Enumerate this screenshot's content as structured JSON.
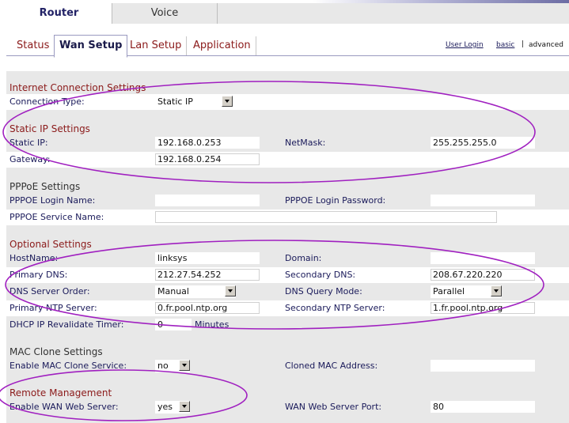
{
  "main_tabs": {
    "router": "Router",
    "voice": "Voice"
  },
  "sub_tabs": {
    "status": "Status",
    "wan_setup": "Wan Setup",
    "lan_setup": "Lan Setup",
    "application": "Application"
  },
  "top_links": {
    "user_login": "User Login",
    "basic": "basic",
    "separator": "|",
    "advanced": "advanced"
  },
  "sections": {
    "internet_connection": "Internet Connection Settings",
    "static_ip": "Static IP Settings",
    "pppoe": "PPPoE Settings",
    "optional": "Optional Settings",
    "mac_clone": "MAC Clone Settings",
    "remote_mgmt": "Remote Management"
  },
  "fields": {
    "connection_type": {
      "label": "Connection Type:",
      "value": "Static IP"
    },
    "static_ip": {
      "label": "Static IP:",
      "value": "192.168.0.253"
    },
    "netmask": {
      "label": "NetMask:",
      "value": "255.255.255.0"
    },
    "gateway": {
      "label": "Gateway:",
      "value": "192.168.0.254"
    },
    "pppoe_login_name": {
      "label": "PPPOE Login Name:",
      "value": ""
    },
    "pppoe_login_password": {
      "label": "PPPOE Login Password:",
      "value": ""
    },
    "pppoe_service_name": {
      "label": "PPPOE Service Name:",
      "value": ""
    },
    "hostname": {
      "label": "HostName:",
      "value": "linksys"
    },
    "domain": {
      "label": "Domain:",
      "value": ""
    },
    "primary_dns": {
      "label": "Primary DNS:",
      "value": "212.27.54.252"
    },
    "secondary_dns": {
      "label": "Secondary DNS:",
      "value": "208.67.220.220"
    },
    "dns_server_order": {
      "label": "DNS Server Order:",
      "value": "Manual"
    },
    "dns_query_mode": {
      "label": "DNS Query Mode:",
      "value": "Parallel"
    },
    "primary_ntp": {
      "label": "Primary NTP Server:",
      "value": "0.fr.pool.ntp.org"
    },
    "secondary_ntp": {
      "label": "Secondary NTP Server:",
      "value": "1.fr.pool.ntp.org"
    },
    "dhcp_revalidate": {
      "label": "DHCP IP Revalidate Timer:",
      "value": "0",
      "unit": "Minutes"
    },
    "enable_mac_clone": {
      "label": "Enable MAC Clone Service:",
      "value": "no"
    },
    "cloned_mac": {
      "label": "Cloned MAC Address:",
      "value": ""
    },
    "enable_wan_web": {
      "label": "Enable WAN Web Server:",
      "value": "yes"
    },
    "wan_web_port": {
      "label": "WAN Web Server Port:",
      "value": "80"
    }
  },
  "colors": {
    "section_title": "#8b1a1a",
    "label": "#1a1a5a",
    "panel": "#e8e8e8",
    "annotation": "#a020c0"
  }
}
